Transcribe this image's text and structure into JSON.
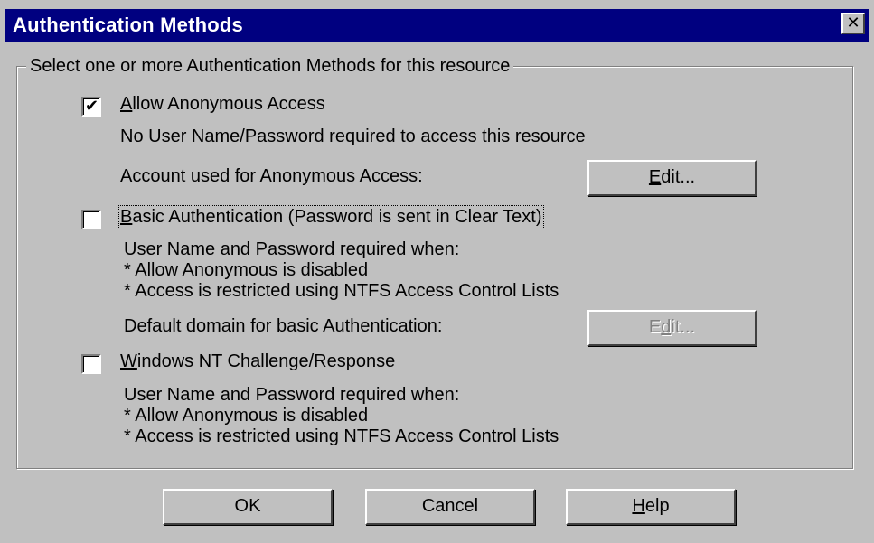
{
  "window": {
    "title": "Authentication Methods",
    "close_glyph": "✕"
  },
  "group": {
    "legend": "Select one or more Authentication Methods for this resource"
  },
  "anonymous": {
    "checked": true,
    "label_underlined": "A",
    "label_rest": "llow Anonymous Access",
    "description": "No User Name/Password required to access this resource",
    "account_label": "Account used for Anonymous Access:",
    "edit_underlined": "E",
    "edit_rest": "dit...",
    "check_glyph": "✔"
  },
  "basic": {
    "checked": false,
    "label_underlined": "B",
    "label_rest": "asic Authentication (Password is sent in Clear Text)",
    "line1": "User Name and Password required when:",
    "line2": "* Allow Anonymous is disabled",
    "line3": "* Access is restricted using NTFS Access Control Lists",
    "domain_label": "Default domain for basic Authentication:",
    "edit_pre": "E",
    "edit_underlined": "d",
    "edit_rest": "it..."
  },
  "ntlm": {
    "checked": false,
    "label_underlined": "W",
    "label_rest": "indows NT Challenge/Response",
    "line1": "User Name and Password required when:",
    "line2": "* Allow Anonymous is disabled",
    "line3": "* Access is restricted using NTFS Access Control Lists"
  },
  "buttons": {
    "ok": "OK",
    "cancel": "Cancel",
    "help_underlined": "H",
    "help_rest": "elp"
  }
}
